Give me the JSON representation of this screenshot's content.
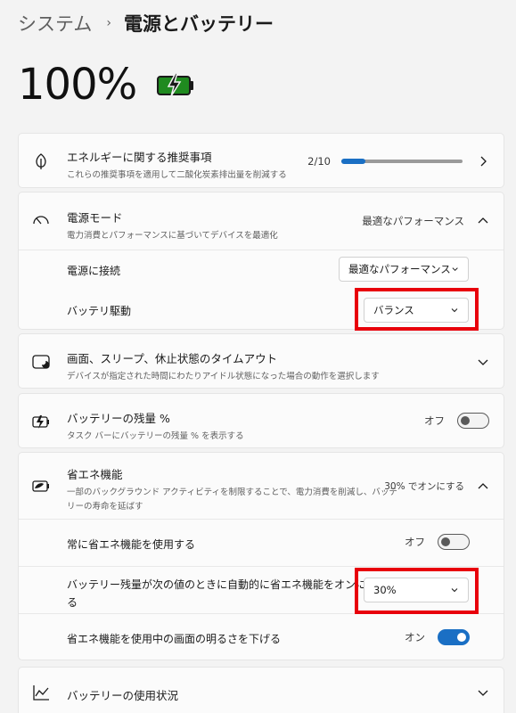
{
  "breadcrumb": {
    "parent": "システム",
    "separator": "›",
    "current": "電源とバッテリー"
  },
  "battery": {
    "percent": "100%"
  },
  "energy": {
    "title": "エネルギーに関する推奨事項",
    "subtitle": "これらの推奨事項を適用して二酸化炭素排出量を削減する",
    "progress_text": "2/10",
    "progress_fraction": 0.2
  },
  "power_mode": {
    "title": "電源モード",
    "subtitle": "電力消費とパフォーマンスに基づいてデバイスを最適化",
    "current": "最適なパフォーマンス",
    "plugged_label": "電源に接続",
    "plugged_value": "最適なパフォーマンス",
    "battery_label": "バッテリ駆動",
    "battery_value": "バランス"
  },
  "screen_sleep": {
    "title": "画面、スリープ、休止状態のタイムアウト",
    "subtitle": "デバイスが指定された時間にわたりアイドル状態になった場合の動作を選択します"
  },
  "battery_percent_setting": {
    "title": "バッテリーの残量 %",
    "subtitle": "タスク バーにバッテリーの残量 % を表示する",
    "state": "オフ"
  },
  "energy_saver": {
    "title": "省エネ機能",
    "subtitle_line1": "一部のバックグラウンド アクティビティを制限することで、電力消費を削減し、バッテ",
    "subtitle_line2": "リーの寿命を延ばす",
    "status": "30% でオンにする",
    "always_label": "常に省エネ機能を使用する",
    "always_state": "オフ",
    "auto_label_line1": "バッテリー残量が次の値のときに自動的に省エネ機能をオンにす",
    "auto_label_line2": "る",
    "auto_value": "30%",
    "dim_label": "省エネ機能を使用中の画面の明るさを下げる",
    "dim_state": "オン"
  },
  "battery_usage": {
    "title": "バッテリーの使用状況"
  },
  "colors": {
    "accent": "#1a6fc4",
    "highlight": "#e8000b",
    "battery_green": "#1f8a1f"
  }
}
